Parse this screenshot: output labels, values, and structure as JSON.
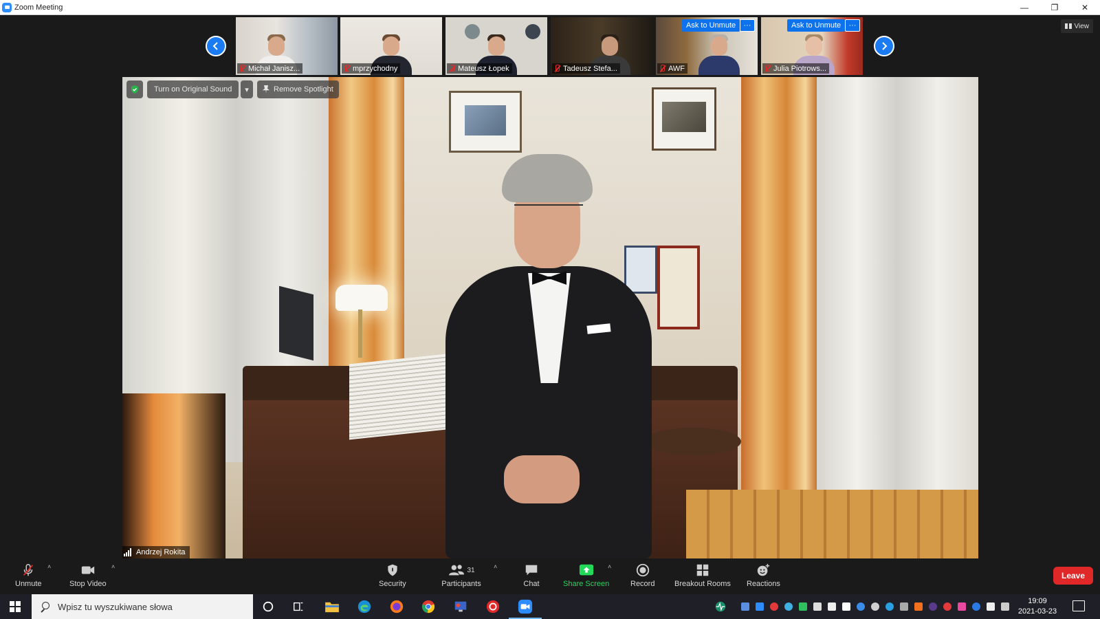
{
  "window": {
    "title": "Zoom Meeting"
  },
  "thumbnails": [
    {
      "name": "Michał Janisz...",
      "ask_unmute": "",
      "more": ""
    },
    {
      "name": "mprzychodny",
      "ask_unmute": "",
      "more": ""
    },
    {
      "name": "Mateusz Łopek",
      "ask_unmute": "",
      "more": ""
    },
    {
      "name": "Tadeusz Stefa...",
      "ask_unmute": "",
      "more": ""
    },
    {
      "name": "AWF",
      "ask_unmute": "Ask to Unmute",
      "more": "···"
    },
    {
      "name": "Julia Piotrows...",
      "ask_unmute": "Ask to Unmute",
      "more": "···"
    }
  ],
  "view_button": "View",
  "main_video": {
    "original_sound_label": "Turn on Original Sound",
    "remove_spotlight_label": "Remove Spotlight",
    "speaker_name": "Andrzej Rokita"
  },
  "toolbar": {
    "unmute": "Unmute",
    "stop_video": "Stop Video",
    "security": "Security",
    "participants": "Participants",
    "participants_count": "31",
    "chat": "Chat",
    "share_screen": "Share Screen",
    "record": "Record",
    "breakout_rooms": "Breakout Rooms",
    "reactions": "Reactions",
    "leave": "Leave",
    "share_color": "#23d959",
    "leave_color": "#e02828"
  },
  "taskbar": {
    "search_placeholder": "Wpisz tu wyszukiwane słowa",
    "time": "19:09",
    "date": "2021-03-23"
  }
}
